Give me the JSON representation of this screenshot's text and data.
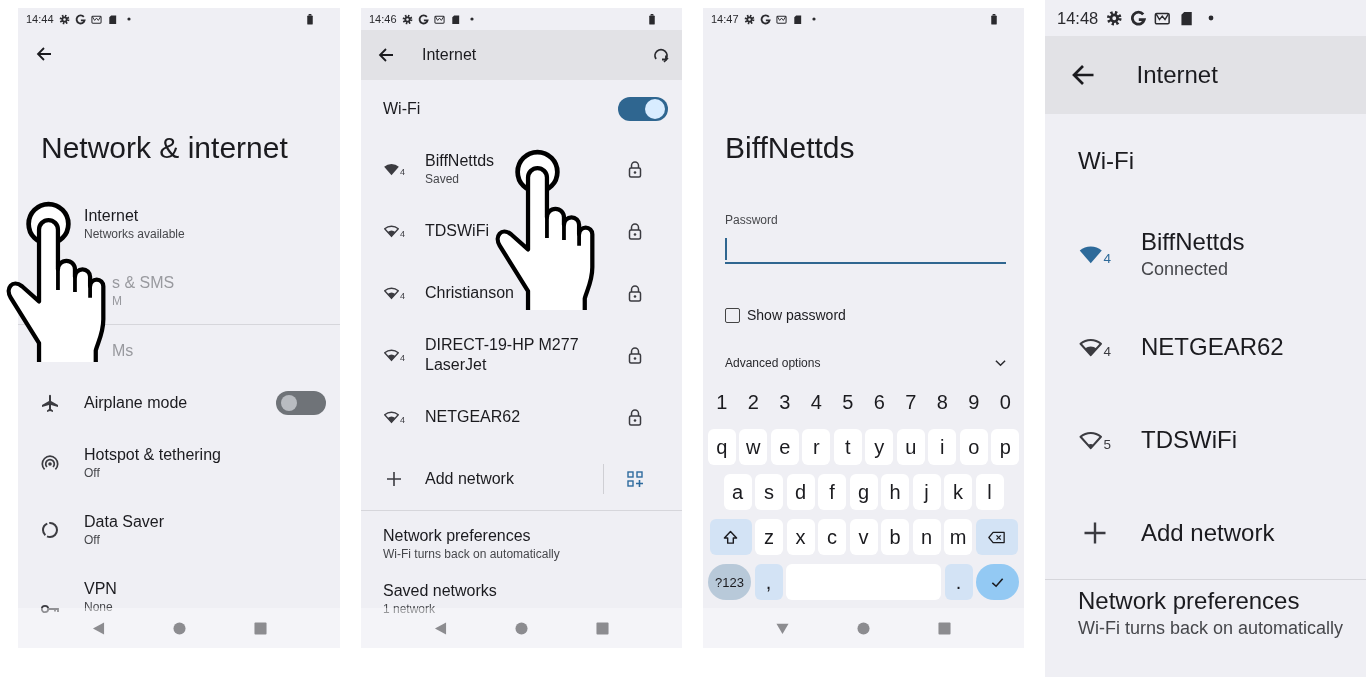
{
  "screens": [
    {
      "kind": "settings",
      "status_bar": {
        "time": "14:44",
        "battery": true
      },
      "title": "Network & internet",
      "pointer": true,
      "rows": [
        {
          "kind": "plain",
          "label": "Internet",
          "summary": "Networks available",
          "disabled": false
        },
        {
          "kind": "covered",
          "label": "s & SMS",
          "summary": "M",
          "disabled": true
        },
        {
          "kind": "divider"
        },
        {
          "kind": "covered",
          "label": "Ms",
          "disabled": true
        },
        {
          "kind": "airplane",
          "label": "Airplane mode",
          "on": false,
          "disabled": false
        },
        {
          "kind": "hotspot",
          "label": "Hotspot & tethering",
          "summary": "Off",
          "disabled": false
        },
        {
          "kind": "data_saver",
          "label": "Data Saver",
          "summary": "Off",
          "disabled": false
        },
        {
          "kind": "vpn",
          "label": "VPN",
          "summary": "None",
          "disabled": false
        }
      ],
      "nav_bar": {
        "kind": "back"
      }
    },
    {
      "kind": "wifi",
      "status_bar": {
        "time": "14:46",
        "battery": true
      },
      "header": {
        "title": "Internet",
        "action": true
      },
      "wifi": {
        "label": "Wi-Fi",
        "on": true
      },
      "pointer": true,
      "networks": [
        {
          "name": "BiffNettds",
          "status": "Saved",
          "kind": "full",
          "standard": "4",
          "connected": false,
          "secured": true
        },
        {
          "name": "TDSWiFi",
          "kind": "partial",
          "standard": "4",
          "connected": false,
          "secured": true
        },
        {
          "name": "Christianson",
          "kind": "partial",
          "standard": "4",
          "connected": false,
          "secured": true
        },
        {
          "name": "DIRECT-19-HP M277 LaserJet",
          "kind": "partial",
          "standard": "4",
          "connected": false,
          "secured": true
        },
        {
          "name": "NETGEAR62",
          "kind": "partial",
          "standard": "4",
          "connected": false,
          "secured": true
        }
      ],
      "add_network": {
        "label": "Add network",
        "qr_code": true
      },
      "preferences": [
        {
          "label": "Network preferences",
          "summary": "Wi-Fi turns back on automatically"
        },
        {
          "label": "Saved networks",
          "summary": "1 network"
        }
      ],
      "nav_bar": {
        "kind": "back"
      }
    },
    {
      "kind": "password",
      "status_bar": {
        "time": "14:47",
        "battery": true
      },
      "title": "BiffNettds",
      "field": {
        "label": "Password",
        "focused": true
      },
      "show_password": {
        "label": "Show password",
        "checked": false
      },
      "advanced": {
        "label": "Advanced options",
        "expanded": false
      },
      "keyboard": {
        "rows": [
          [
            {
              "kind": "digit",
              "label": "1"
            },
            {
              "kind": "digit",
              "label": "2"
            },
            {
              "kind": "digit",
              "label": "3"
            },
            {
              "kind": "digit",
              "label": "4"
            },
            {
              "kind": "digit",
              "label": "5"
            },
            {
              "kind": "digit",
              "label": "6"
            },
            {
              "kind": "digit",
              "label": "7"
            },
            {
              "kind": "digit",
              "label": "8"
            },
            {
              "kind": "digit",
              "label": "9"
            },
            {
              "kind": "digit",
              "label": "0"
            }
          ],
          [
            {
              "kind": "letter",
              "label": "q"
            },
            {
              "kind": "letter",
              "label": "w"
            },
            {
              "kind": "letter",
              "label": "e"
            },
            {
              "kind": "letter",
              "label": "r"
            },
            {
              "kind": "letter",
              "label": "t"
            },
            {
              "kind": "letter",
              "label": "y"
            },
            {
              "kind": "letter",
              "label": "u"
            },
            {
              "kind": "letter",
              "label": "i"
            },
            {
              "kind": "letter",
              "label": "o"
            },
            {
              "kind": "letter",
              "label": "p"
            }
          ],
          [
            {
              "kind": "letter",
              "label": "a"
            },
            {
              "kind": "letter",
              "label": "s"
            },
            {
              "kind": "letter",
              "label": "d"
            },
            {
              "kind": "letter",
              "label": "f"
            },
            {
              "kind": "letter",
              "label": "g"
            },
            {
              "kind": "letter",
              "label": "h"
            },
            {
              "kind": "letter",
              "label": "j"
            },
            {
              "kind": "letter",
              "label": "k"
            },
            {
              "kind": "letter",
              "label": "l"
            }
          ],
          [
            {
              "kind": "shift"
            },
            {
              "kind": "letter",
              "label": "z"
            },
            {
              "kind": "letter",
              "label": "x"
            },
            {
              "kind": "letter",
              "label": "c"
            },
            {
              "kind": "letter",
              "label": "v"
            },
            {
              "kind": "letter",
              "label": "b"
            },
            {
              "kind": "letter",
              "label": "n"
            },
            {
              "kind": "letter",
              "label": "m"
            },
            {
              "kind": "backspace"
            }
          ],
          [
            {
              "kind": "symbols",
              "label": "?123"
            },
            {
              "kind": "punct",
              "label": ","
            },
            {
              "kind": "space"
            },
            {
              "kind": "punct",
              "label": "."
            },
            {
              "kind": "enter"
            }
          ]
        ]
      },
      "nav_bar": {
        "kind": "hide_keyboard"
      }
    },
    {
      "kind": "wifi_large",
      "status_bar": {
        "time": "14:48"
      },
      "header": {
        "title": "Internet"
      },
      "wifi": {
        "label": "Wi-Fi"
      },
      "networks": [
        {
          "name": "BiffNettds",
          "status": "Connected",
          "kind": "full",
          "standard": "4",
          "connected": true
        },
        {
          "name": "NETGEAR62",
          "kind": "partial",
          "standard": "4",
          "connected": false
        },
        {
          "name": "TDSWiFi",
          "kind": "empty",
          "standard": "5",
          "connected": false
        }
      ],
      "add_network": {
        "label": "Add network"
      },
      "preferences": [
        {
          "label": "Network preferences",
          "summary": "Wi-Fi turns back on automatically"
        }
      ]
    }
  ]
}
